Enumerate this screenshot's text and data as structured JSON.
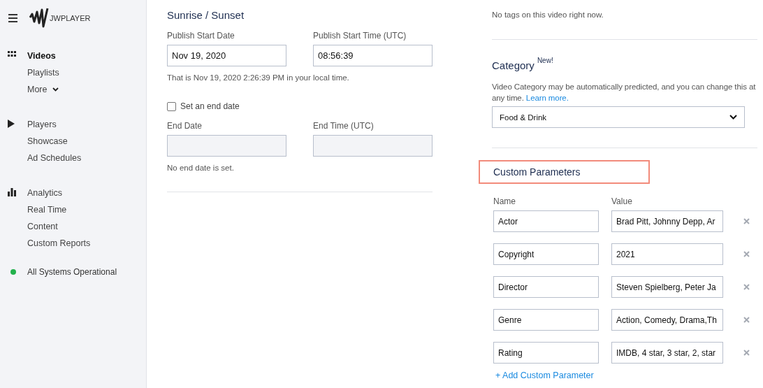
{
  "sidebar": {
    "logo": "JWPLAYER",
    "groups": [
      {
        "kind": "grid",
        "items": [
          {
            "label": "Videos",
            "selected": true,
            "kind": "link"
          },
          {
            "label": "Playlists",
            "selected": false,
            "kind": "link"
          },
          {
            "label": "More",
            "selected": false,
            "kind": "dropdown"
          }
        ]
      },
      {
        "kind": "play",
        "items": [
          {
            "label": "Players",
            "selected": false,
            "kind": "link"
          },
          {
            "label": "Showcase",
            "selected": false,
            "kind": "link"
          },
          {
            "label": "Ad Schedules",
            "selected": false,
            "kind": "link"
          }
        ]
      },
      {
        "kind": "bars",
        "items": [
          {
            "label": "Analytics",
            "selected": false,
            "kind": "link"
          },
          {
            "label": "Real Time",
            "selected": false,
            "kind": "link"
          },
          {
            "label": "Content",
            "selected": false,
            "kind": "link"
          },
          {
            "label": "Custom Reports",
            "selected": false,
            "kind": "link"
          }
        ]
      }
    ],
    "status": {
      "label": "All Systems Operational",
      "color": "#22b14c"
    }
  },
  "sunrise_sunset": {
    "title": "Sunrise / Sunset",
    "start_fields": [
      {
        "label": "Publish Start Date",
        "value": "Nov 19, 2020",
        "disabled": false
      },
      {
        "label": "Publish Start Time (UTC)",
        "value": "08:56:39",
        "disabled": false
      }
    ],
    "local_time_note": "That is Nov 19, 2020 2:26:39 PM in your local time.",
    "end_date_checkbox": {
      "label": "Set an end date",
      "checked": false
    },
    "end_fields": [
      {
        "label": "End Date",
        "disabled": true
      },
      {
        "label": "End Time (UTC)",
        "disabled": true
      }
    ],
    "end_note": "No end date is set."
  },
  "tags": {
    "message": "No tags on this video right now."
  },
  "category": {
    "title": "Category",
    "badge": "New!",
    "description": "Video Category may be automatically predicted, and you can change this at any time.",
    "link": "Learn more.",
    "value": "Food & Drink"
  },
  "custom_parameters": {
    "title": "Custom Parameters",
    "highlighted": true,
    "columns": [
      "Name",
      "Value"
    ],
    "rows": [
      {
        "name": "Actor",
        "value": "Brad Pitt, Johnny Depp, Ar"
      },
      {
        "name": "Copyright",
        "value": "2021"
      },
      {
        "name": "Director",
        "value": "Steven Spielberg, Peter Ja"
      },
      {
        "name": "Genre",
        "value": "Action, Comedy, Drama,Th"
      },
      {
        "name": "Rating",
        "value": "IMDB, 4 star, 3 star, 2, star"
      }
    ],
    "add_link": "+ Add Custom Parameter"
  }
}
